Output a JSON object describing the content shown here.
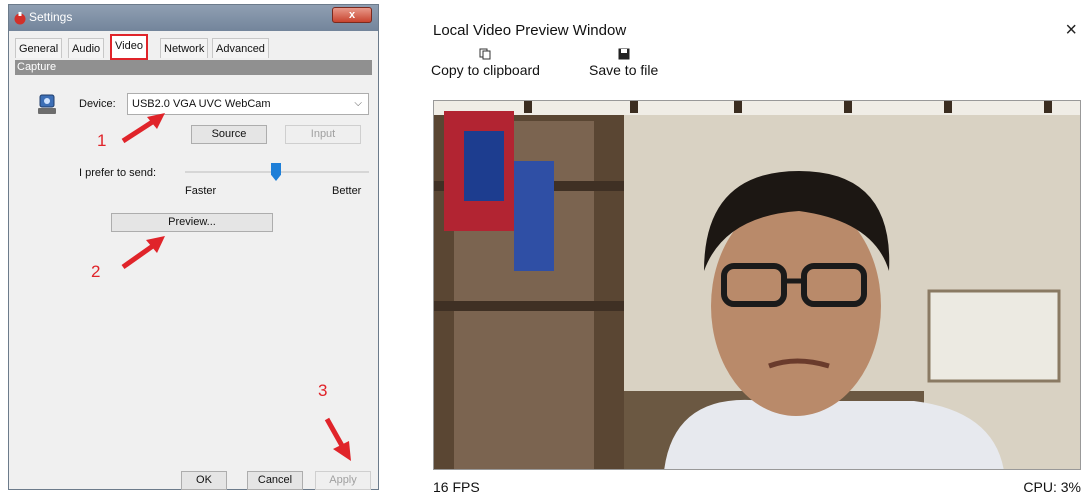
{
  "settings": {
    "title": "Settings",
    "close_glyph": "x",
    "tabs": [
      "General",
      "Audio",
      "Video",
      "Network",
      "Advanced"
    ],
    "section": "Capture",
    "device_label": "Device:",
    "device_value": "USB2.0 VGA UVC WebCam",
    "source_button": "Source",
    "input_button": "Input",
    "prefer_label": "I prefer to send:",
    "slider_min_label": "Faster",
    "slider_max_label": "Better",
    "slider_level": 0.5,
    "preview_button": "Preview...",
    "ok_button": "OK",
    "cancel_button": "Cancel",
    "apply_button": "Apply",
    "annotations": [
      "1",
      "2",
      "3"
    ],
    "accent_color": "#e0242a"
  },
  "preview": {
    "title": "Local Video Preview Window",
    "close_glyph": "×",
    "toolbar": {
      "copy_label": "Copy to clipboard",
      "save_label": "Save to file"
    },
    "fps": "16 FPS",
    "cpu": "CPU: 3%"
  }
}
